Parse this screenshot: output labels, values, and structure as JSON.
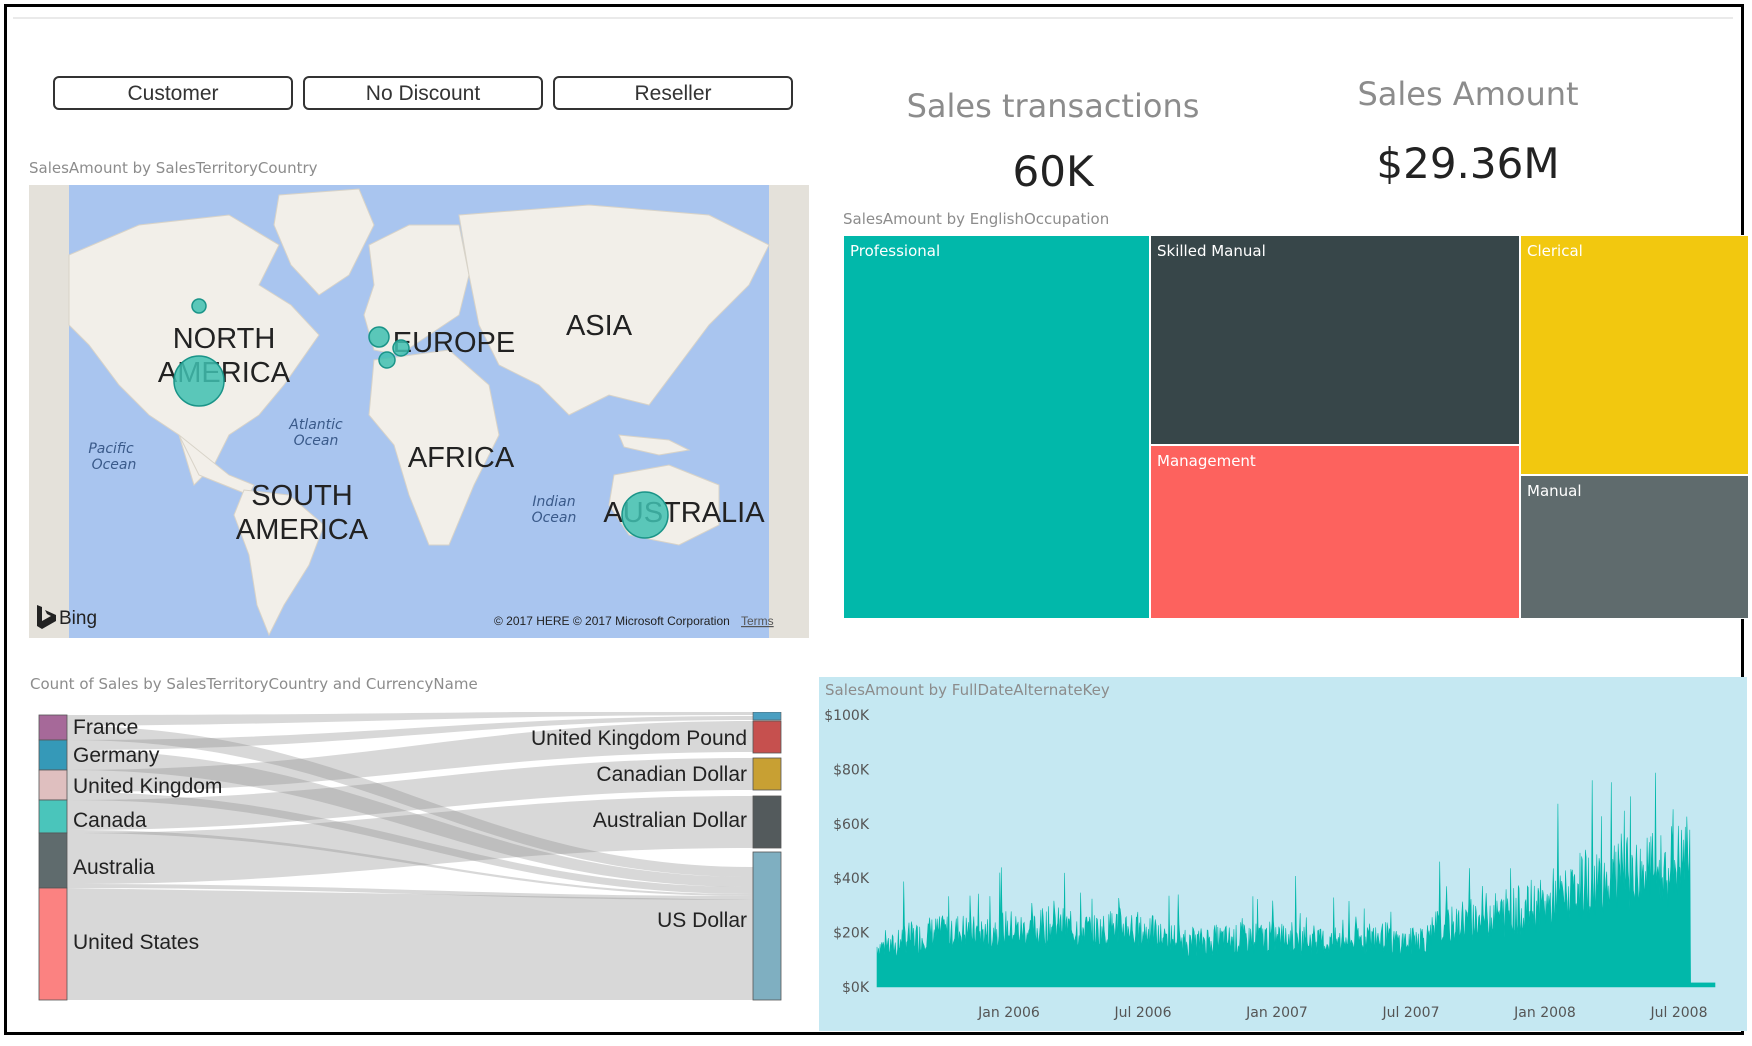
{
  "slicer": {
    "buttons": [
      "Customer",
      "No Discount",
      "Reseller"
    ]
  },
  "cards": [
    {
      "label": "Sales transactions",
      "value": "60K"
    },
    {
      "label": "Sales Amount",
      "value": "$29.36M"
    }
  ],
  "map": {
    "title": "SalesAmount by SalesTerritoryCountry",
    "labels": {
      "north_america_1": "NORTH",
      "north_america_2": "AMERICA",
      "europe": "EUROPE",
      "asia": "ASIA",
      "africa": "AFRICA",
      "south_america_1": "SOUTH",
      "south_america_2": "AMERICA",
      "australia": "AUSTRALIA",
      "atlantic_1": "Atlantic",
      "atlantic_2": "Ocean",
      "pacific_1": "Pacific",
      "pacific_2": "Ocean",
      "indian_1": "Indian",
      "indian_2": "Ocean"
    },
    "brand": "Bing",
    "copyright": "© 2017 HERE © 2017 Microsoft Corporation",
    "terms": "Terms",
    "colors": {
      "water": "#a9c5ef",
      "land": "#f2efe9",
      "bubble": "#3fbfb0"
    }
  },
  "treemap": {
    "title": "SalesAmount by EnglishOccupation",
    "items": [
      {
        "label": "Professional",
        "color": "#01b8aa"
      },
      {
        "label": "Skilled Manual",
        "color": "#374649"
      },
      {
        "label": "Management",
        "color": "#fd625e"
      },
      {
        "label": "Clerical",
        "color": "#f2c80f"
      },
      {
        "label": "Manual",
        "color": "#5f6b6d"
      }
    ]
  },
  "sankey": {
    "title": "Count of Sales by SalesTerritoryCountry and CurrencyName",
    "sources": [
      {
        "label": "France",
        "color": "#a66999"
      },
      {
        "label": "Germany",
        "color": "#3599b8"
      },
      {
        "label": "United Kingdom",
        "color": "#dfbfbf"
      },
      {
        "label": "Canada",
        "color": "#4ac5bb"
      },
      {
        "label": "Australia",
        "color": "#5f6b6d"
      },
      {
        "label": "United States",
        "color": "#fb8281"
      }
    ],
    "targets": [
      {
        "label": "United Kingdom Pound",
        "color": "#c6504e"
      },
      {
        "label": "Canadian Dollar",
        "color": "#c8a033"
      },
      {
        "label": "Australian Dollar",
        "color": "#535a5c"
      },
      {
        "label": "US Dollar",
        "color": "#7fafc1"
      }
    ]
  },
  "line": {
    "title": "SalesAmount by FullDateAlternateKey",
    "y_ticks": [
      "$100K",
      "$80K",
      "$60K",
      "$40K",
      "$20K",
      "$0K"
    ],
    "x_ticks": [
      "Jan 2006",
      "Jul 2006",
      "Jan 2007",
      "Jul 2007",
      "Jan 2008",
      "Jul 2008"
    ],
    "color": "#01b8aa"
  },
  "chart_data": {
    "type": "area",
    "title": "SalesAmount by FullDateAlternateKey",
    "xlabel": "",
    "ylabel": "",
    "ylim": [
      0,
      100000
    ],
    "x_range": [
      "2005-07-01",
      "2008-07-31"
    ],
    "series": [
      {
        "values_monthly_approx": [
          18000,
          22000,
          24000,
          25000,
          24000,
          26000,
          25000,
          27000,
          26000,
          25000,
          27000,
          24000,
          22000,
          20000,
          21000,
          21000,
          22000,
          22000,
          21000,
          20000,
          21000,
          22000,
          20000,
          22000,
          27000,
          30000,
          32000,
          34000,
          36000,
          40000,
          45000,
          48000,
          50000,
          52000,
          55000,
          58000,
          1500
        ]
      }
    ]
  }
}
